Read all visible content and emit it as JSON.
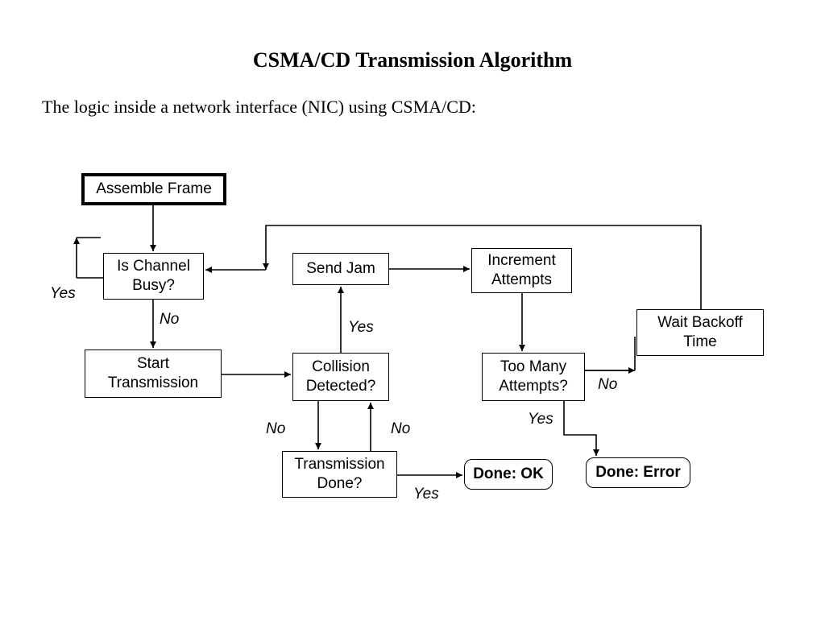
{
  "title": "CSMA/CD Transmission Algorithm",
  "subtitle": "The logic inside a network interface (NIC) using CSMA/CD:",
  "nodes": {
    "assemble": "Assemble Frame",
    "channel": "Is Channel Busy?",
    "start": "Start Transmission",
    "sendjam": "Send Jam",
    "collision": "Collision Detected?",
    "txdone": "Transmission Done?",
    "increment": "Increment Attempts",
    "toomany": "Too Many Attempts?",
    "backoff": "Wait Backoff Time",
    "doneok": "Done: OK",
    "doneerr": "Done: Error"
  },
  "edges": {
    "yes1": "Yes",
    "no1": "No",
    "yes2": "Yes",
    "no2": "No",
    "no3": "No",
    "yes3": "Yes",
    "no4": "No",
    "yes4": "Yes"
  }
}
